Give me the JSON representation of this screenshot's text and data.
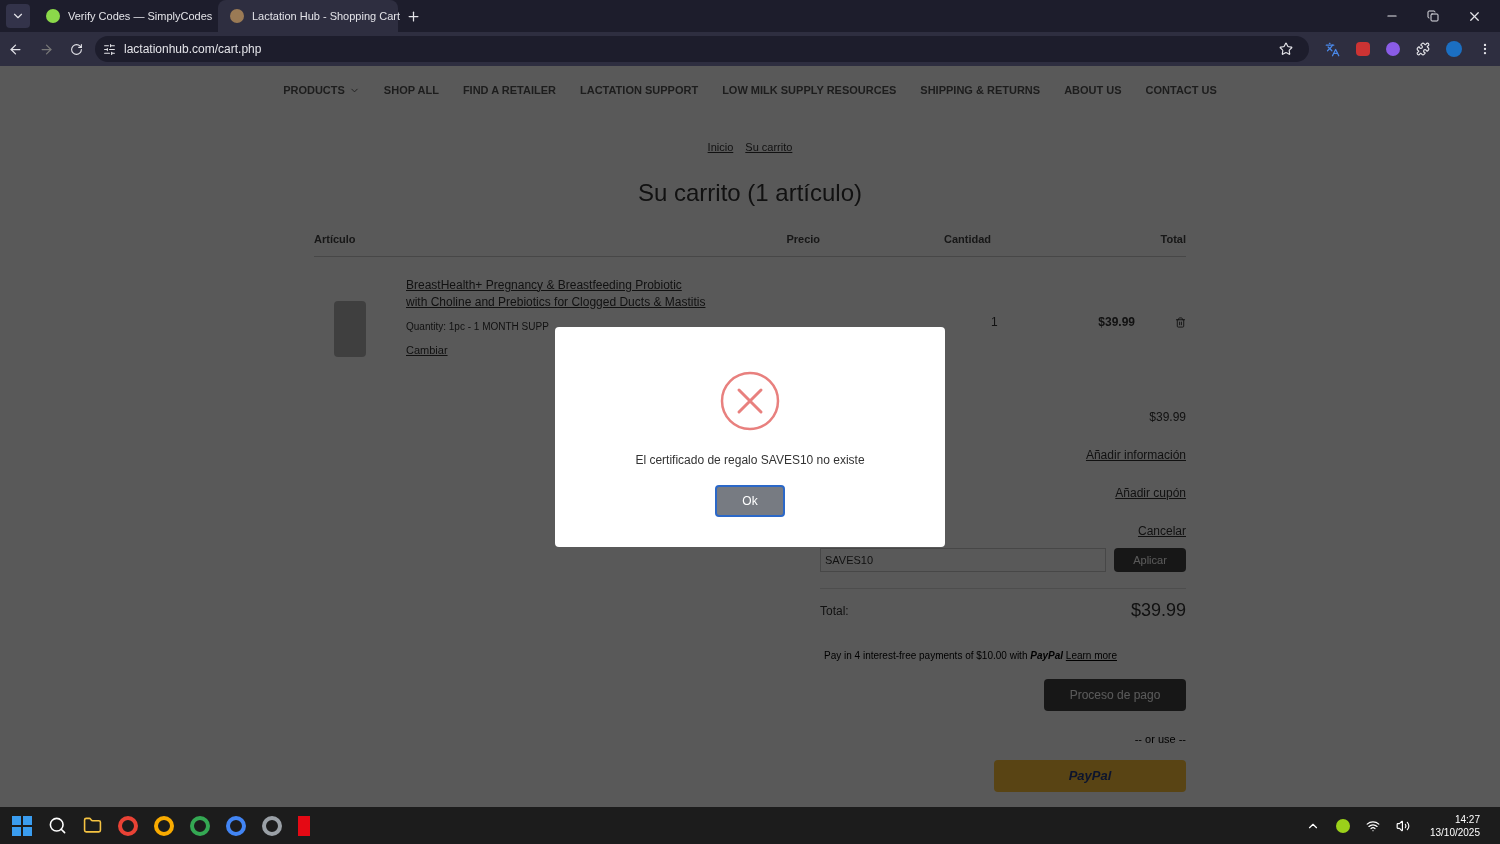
{
  "browser": {
    "tabs": [
      {
        "title": "Verify Codes — SimplyCodes",
        "selected": false
      },
      {
        "title": "Lactation Hub - Shopping Cart",
        "selected": true
      }
    ],
    "url": "lactationhub.com/cart.php"
  },
  "nav": [
    {
      "label": "PRODUCTS",
      "dropdown": true
    },
    {
      "label": "SHOP ALL",
      "dropdown": false
    },
    {
      "label": "FIND A RETAILER",
      "dropdown": false
    },
    {
      "label": "LACTATION SUPPORT",
      "dropdown": false
    },
    {
      "label": "LOW MILK SUPPLY RESOURCES",
      "dropdown": false
    },
    {
      "label": "SHIPPING & RETURNS",
      "dropdown": false
    },
    {
      "label": "ABOUT US",
      "dropdown": false
    },
    {
      "label": "CONTACT US",
      "dropdown": false
    }
  ],
  "breadcrumbs": [
    "Inicio",
    "Su carrito"
  ],
  "heading": "Su carrito (1 artículo)",
  "table": {
    "columns": [
      "Artículo",
      "Precio",
      "Cantidad",
      "Total"
    ],
    "rows": [
      {
        "name": "BreastHealth+ Pregnancy & Breastfeeding Probiotic with Choline and Prebiotics for Clogged Ducts & Mastitis",
        "option": "Quantity: 1pc - 1 MONTH SUPP",
        "change": "Cambiar",
        "quantity": "1",
        "total": "$39.99"
      }
    ]
  },
  "summary": {
    "subtotal": "$39.99",
    "shipping_link": "Añadir información",
    "coupon_link": "Añadir cupón",
    "cancel_link": "Cancelar",
    "gift_code": "SAVES10",
    "apply": "Aplicar",
    "total_label": "Total:",
    "total": "$39.99",
    "paypal_text": "Pay in 4 interest-free payments of $10.00 with",
    "paypal_brand": "PayPal",
    "learn_more": "Learn more",
    "checkout": "Proceso de pago",
    "or_use": "-- or use --",
    "paypal_button": "PayPal"
  },
  "dialog": {
    "message": "El certificado de regalo SAVES10 no existe",
    "button": "Ok"
  },
  "taskbar": {
    "time": "14:27",
    "date": "13/10/2025"
  }
}
